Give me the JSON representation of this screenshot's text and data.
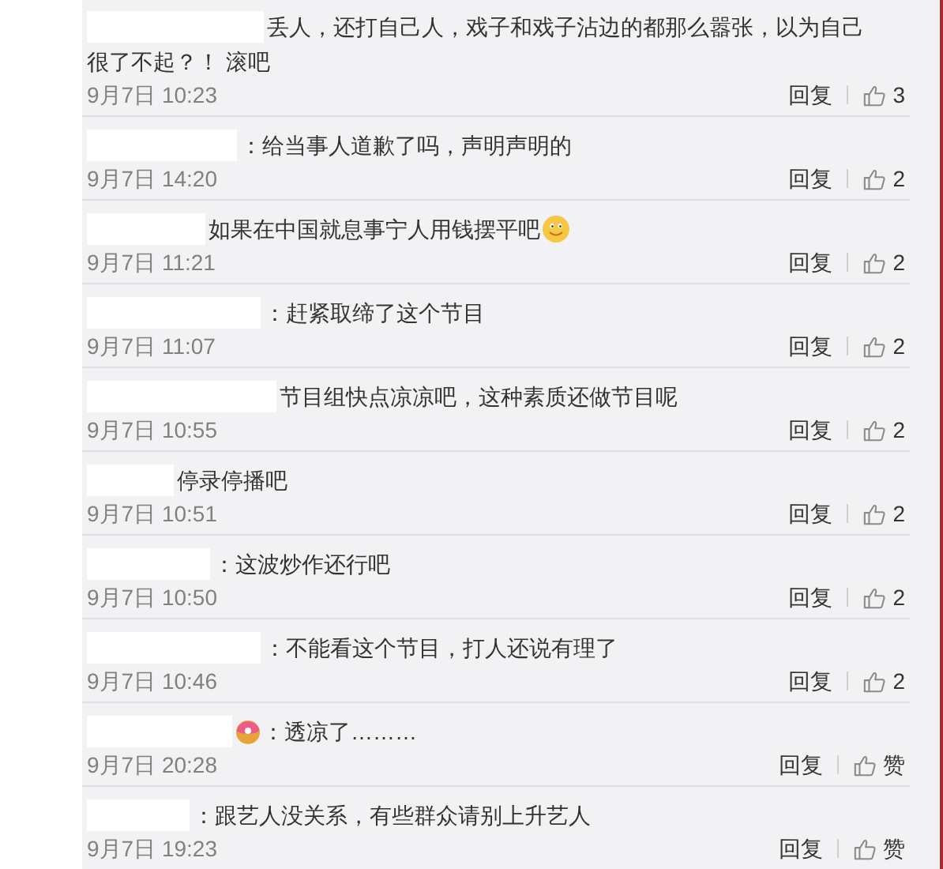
{
  "comments": [
    {
      "parts": [
        {
          "kind": "text",
          "text": "丢人，还打自己人，戏子和戏子沾边的都那么嚣张，以为自己"
        },
        {
          "kind": "line_break"
        },
        {
          "kind": "text",
          "text": "很了不起？！ 滚吧"
        }
      ],
      "time": "9月7日 10:23",
      "reply": "回复",
      "likes": "3"
    },
    {
      "parts": [
        {
          "kind": "text",
          "text": "：给当事人道歉了吗，声明声明的"
        }
      ],
      "time": "9月7日 14:20",
      "reply": "回复",
      "likes": "2"
    },
    {
      "parts": [
        {
          "kind": "text",
          "text": "如果在中国就息事宁人用钱摆平吧"
        },
        {
          "kind": "smiley"
        }
      ],
      "time": "9月7日 11:21",
      "reply": "回复",
      "likes": "2"
    },
    {
      "parts": [
        {
          "kind": "text",
          "text": "：赶紧取缔了这个节目"
        }
      ],
      "time": "9月7日 11:07",
      "reply": "回复",
      "likes": "2"
    },
    {
      "parts": [
        {
          "kind": "text",
          "text": "节目组快点凉凉吧，这种素质还做节目呢"
        }
      ],
      "time": "9月7日 10:55",
      "reply": "回复",
      "likes": "2"
    },
    {
      "parts": [
        {
          "kind": "text",
          "text": "停录停播吧"
        }
      ],
      "time": "9月7日 10:51",
      "reply": "回复",
      "likes": "2"
    },
    {
      "parts": [
        {
          "kind": "text",
          "text": "：这波炒作还行吧"
        }
      ],
      "time": "9月7日 10:50",
      "reply": "回复",
      "likes": "2"
    },
    {
      "parts": [
        {
          "kind": "text",
          "text": "：不能看这个节目，打人还说有理了"
        }
      ],
      "time": "9月7日 10:46",
      "reply": "回复",
      "likes": "2"
    },
    {
      "parts": [
        {
          "kind": "donut"
        },
        {
          "kind": "text",
          "text": "：透凉了………"
        }
      ],
      "time": "9月7日 20:28",
      "reply": "回复",
      "likes": "赞"
    },
    {
      "parts": [
        {
          "kind": "text",
          "text": "：跟艺人没关系，有些群众请别上升艺人"
        }
      ],
      "time": "9月7日 19:23",
      "reply": "回复",
      "likes": "赞"
    }
  ]
}
